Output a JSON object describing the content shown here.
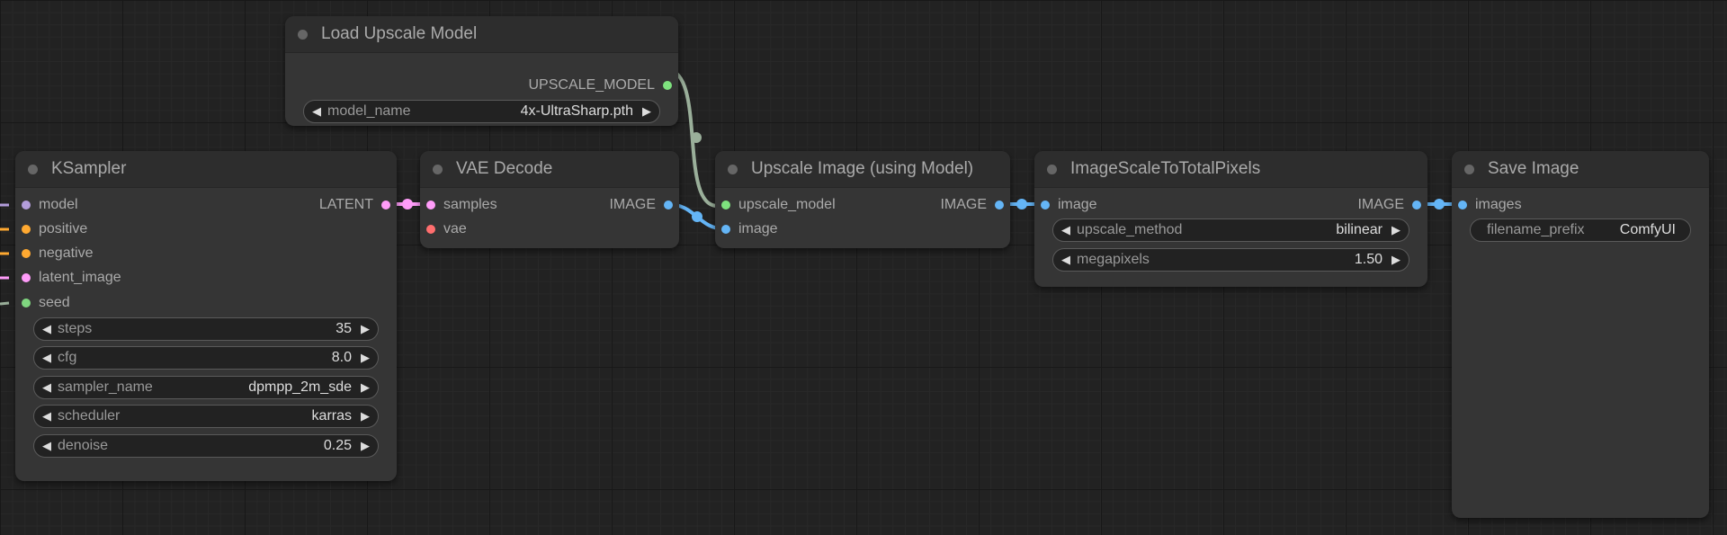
{
  "colors": {
    "model": "#b39ddb",
    "conditioning": "#ffa931",
    "latent": "#ff9cf9",
    "int": "#7fd67f",
    "vae": "#ff6e6e",
    "image": "#64b5f6",
    "upscale_model": "#7ee27e",
    "wire_gray": "#9aaf9a"
  },
  "nodes": {
    "load_upscale": {
      "title": "Load Upscale Model",
      "output": "UPSCALE_MODEL",
      "model_name": {
        "label": "model_name",
        "value": "4x-UltraSharp.pth"
      }
    },
    "ksampler": {
      "title": "KSampler",
      "inputs": [
        "model",
        "positive",
        "negative",
        "latent_image",
        "seed"
      ],
      "output": "LATENT",
      "widgets": [
        {
          "label": "steps",
          "value": "35"
        },
        {
          "label": "cfg",
          "value": "8.0"
        },
        {
          "label": "sampler_name",
          "value": "dpmpp_2m_sde"
        },
        {
          "label": "scheduler",
          "value": "karras"
        },
        {
          "label": "denoise",
          "value": "0.25"
        }
      ]
    },
    "vae_decode": {
      "title": "VAE Decode",
      "inputs": [
        "samples",
        "vae"
      ],
      "output": "IMAGE"
    },
    "upscale_image": {
      "title": "Upscale Image (using Model)",
      "inputs": [
        "upscale_model",
        "image"
      ],
      "output": "IMAGE"
    },
    "scale_total": {
      "title": "ImageScaleToTotalPixels",
      "input": "image",
      "output": "IMAGE",
      "widgets": [
        {
          "label": "upscale_method",
          "value": "bilinear"
        },
        {
          "label": "megapixels",
          "value": "1.50"
        }
      ]
    },
    "save_image": {
      "title": "Save Image",
      "input": "images",
      "filename_prefix": {
        "label": "filename_prefix",
        "value": "ComfyUI"
      }
    }
  }
}
